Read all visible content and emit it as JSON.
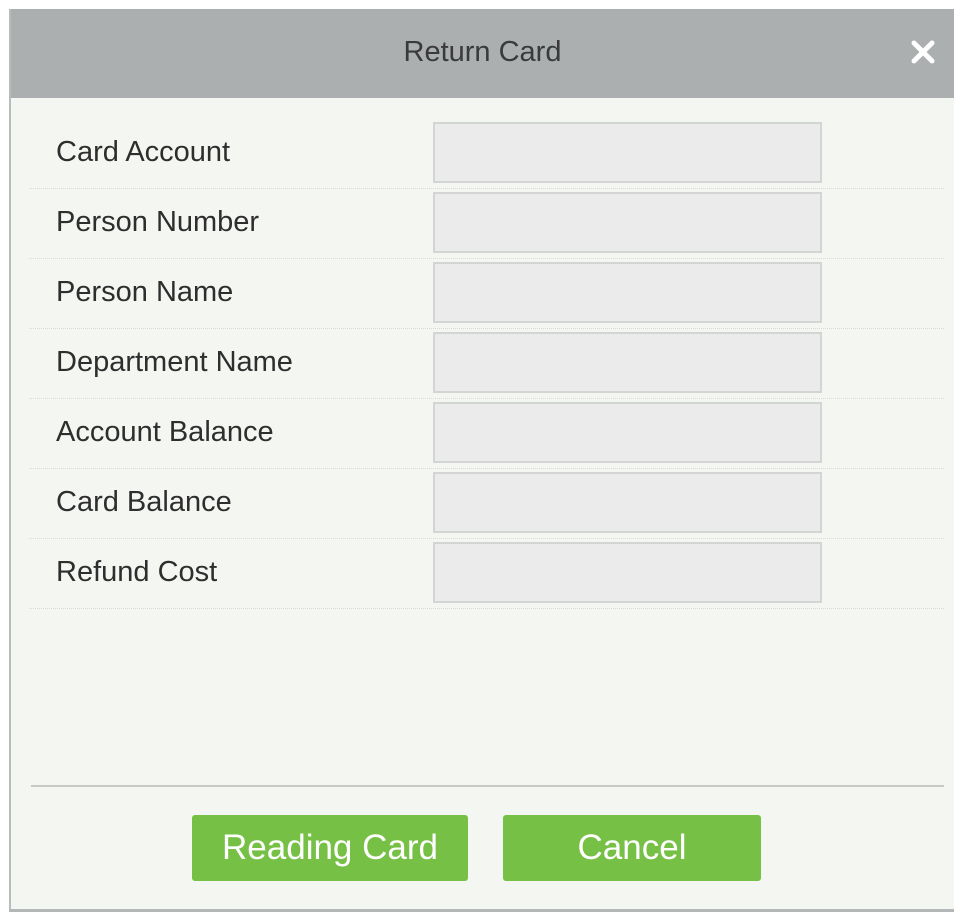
{
  "dialog": {
    "title": "Return Card",
    "close_icon": "close-icon"
  },
  "form": {
    "fields": [
      {
        "label": "Card Account",
        "value": ""
      },
      {
        "label": "Person Number",
        "value": ""
      },
      {
        "label": "Person Name",
        "value": ""
      },
      {
        "label": "Department Name",
        "value": ""
      },
      {
        "label": "Account Balance",
        "value": ""
      },
      {
        "label": "Card Balance",
        "value": ""
      },
      {
        "label": "Refund Cost",
        "value": ""
      }
    ]
  },
  "buttons": {
    "reading_card_label": "Reading Card",
    "cancel_label": "Cancel"
  },
  "colors": {
    "titlebar": "#abafb0",
    "body": "#f4f6f2",
    "button": "#77c046",
    "input_bg": "#eaebea"
  }
}
